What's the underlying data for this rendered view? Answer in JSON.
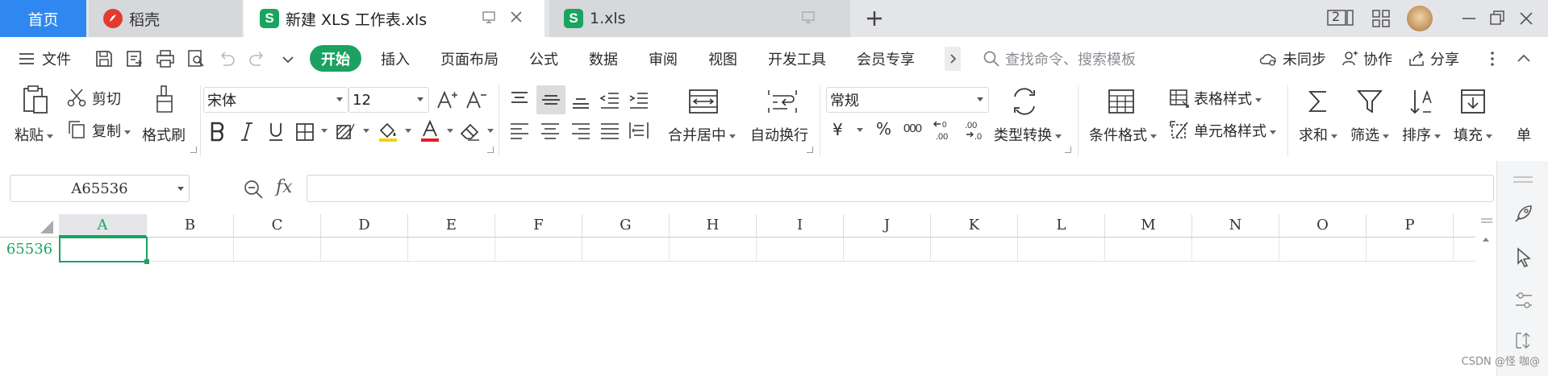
{
  "tabs": {
    "home": "首页",
    "daoke": "稻壳",
    "active_doc": "新建 XLS 工作表.xls",
    "other_doc": "1.xls",
    "s_badge": "S",
    "new_tab_icon": "plus-icon"
  },
  "window": {
    "doc_count": "2"
  },
  "menu": {
    "file": "文件",
    "items": [
      "开始",
      "插入",
      "页面布局",
      "公式",
      "数据",
      "审阅",
      "视图",
      "开发工具",
      "会员专享"
    ],
    "search_placeholder": "查找命令、搜索模板",
    "unsynced": "未同步",
    "collab": "协作",
    "share": "分享"
  },
  "ribbon": {
    "paste": "粘贴",
    "cut": "剪切",
    "copy": "复制",
    "format_painter": "格式刷",
    "font_name": "宋体",
    "font_size": "12",
    "merge_center": "合并居中",
    "wrap_text": "自动换行",
    "number_format": "常规",
    "currency": "¥",
    "percent": "%",
    "thousands": "000",
    "type_convert": "类型转换",
    "conditional_format": "条件格式",
    "table_style": "表格样式",
    "cell_style": "单元格样式",
    "sum": "求和",
    "filter": "筛选",
    "sort": "排序",
    "fill": "填充",
    "single": "单",
    "accent_color": "#1ba261",
    "font_color_bar": "#e02020",
    "highlight_bar": "#f5d000"
  },
  "formula_bar": {
    "name_box": "A65536",
    "fx": "fx",
    "value": ""
  },
  "sheet": {
    "columns": [
      "A",
      "B",
      "C",
      "D",
      "E",
      "F",
      "G",
      "H",
      "I",
      "J",
      "K",
      "L",
      "M",
      "N",
      "O",
      "P"
    ],
    "row_number": "65536",
    "selected_column": "A"
  },
  "watermark": "CSDN @怪 咖@"
}
